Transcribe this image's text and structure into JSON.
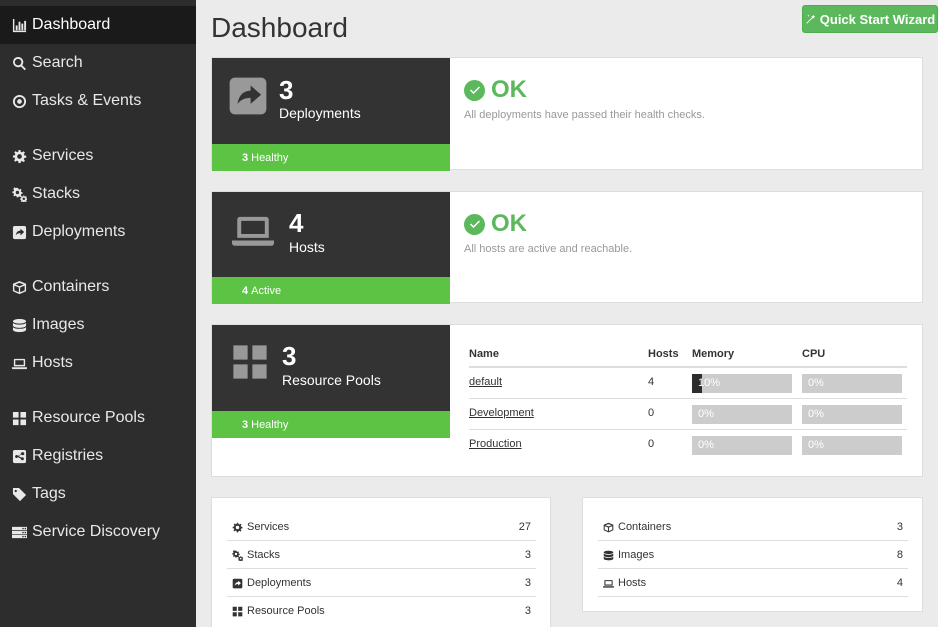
{
  "sidebar": {
    "items": [
      {
        "label": "Dashboard",
        "icon": "bar-chart-icon"
      },
      {
        "label": "Search",
        "icon": "search-icon"
      },
      {
        "label": "Tasks & Events",
        "icon": "target-icon"
      },
      {
        "label": "Services",
        "icon": "cog-icon"
      },
      {
        "label": "Stacks",
        "icon": "cogs-icon"
      },
      {
        "label": "Deployments",
        "icon": "share-square-icon"
      },
      {
        "label": "Containers",
        "icon": "cube-icon"
      },
      {
        "label": "Images",
        "icon": "database-icon"
      },
      {
        "label": "Hosts",
        "icon": "laptop-icon"
      },
      {
        "label": "Resource Pools",
        "icon": "th-large-icon"
      },
      {
        "label": "Registries",
        "icon": "share-alt-icon"
      },
      {
        "label": "Tags",
        "icon": "tag-icon"
      },
      {
        "label": "Service Discovery",
        "icon": "server-icon"
      }
    ]
  },
  "header": {
    "title": "Dashboard",
    "quick_start_label": "Quick Start Wizard"
  },
  "cards": {
    "deployments": {
      "count": "3",
      "label": "Deployments",
      "badge_count": "3",
      "badge_text": "Healthy",
      "status": "OK",
      "desc": "All deployments have passed their health checks."
    },
    "hosts": {
      "count": "4",
      "label": "Hosts",
      "badge_count": "4",
      "badge_text": "Active",
      "status": "OK",
      "desc": "All hosts are active and reachable."
    },
    "pools": {
      "count": "3",
      "label": "Resource Pools",
      "badge_count": "3",
      "badge_text": "Healthy"
    }
  },
  "pool_table": {
    "headers": {
      "name": "Name",
      "hosts": "Hosts",
      "memory": "Memory",
      "cpu": "CPU"
    },
    "rows": [
      {
        "name": "default",
        "hosts": "4",
        "memory": "10%",
        "memory_fraction": 0.1,
        "cpu": "0%",
        "cpu_fraction": 0
      },
      {
        "name": "Development",
        "hosts": "0",
        "memory": "0%",
        "memory_fraction": 0,
        "cpu": "0%",
        "cpu_fraction": 0
      },
      {
        "name": "Production",
        "hosts": "0",
        "memory": "0%",
        "memory_fraction": 0,
        "cpu": "0%",
        "cpu_fraction": 0
      }
    ]
  },
  "summary_left": [
    {
      "label": "Services",
      "value": "27",
      "icon": "cog-icon"
    },
    {
      "label": "Stacks",
      "value": "3",
      "icon": "cogs-icon"
    },
    {
      "label": "Deployments",
      "value": "3",
      "icon": "share-square-icon"
    },
    {
      "label": "Resource Pools",
      "value": "3",
      "icon": "th-large-icon"
    }
  ],
  "summary_right": [
    {
      "label": "Containers",
      "value": "3",
      "icon": "cube-icon"
    },
    {
      "label": "Images",
      "value": "8",
      "icon": "database-icon"
    },
    {
      "label": "Hosts",
      "value": "4",
      "icon": "laptop-icon"
    }
  ],
  "colors": {
    "sidebar": "#2d2d2d",
    "accent_green": "#5cb85c",
    "badge_green": "#5cc345",
    "card_dark": "#333333"
  }
}
